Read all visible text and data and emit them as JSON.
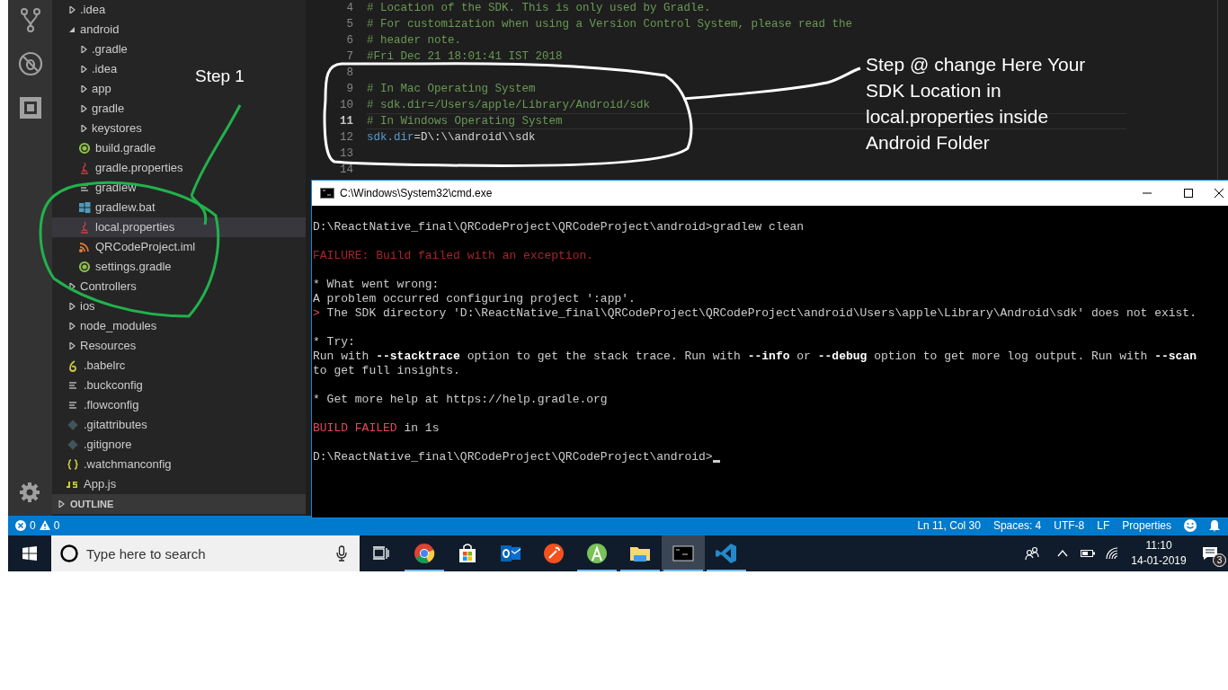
{
  "explorer": {
    "tree": [
      {
        "label": ".idea",
        "kind": "folder",
        "expanded": false,
        "selected": false
      },
      {
        "label": "android",
        "kind": "folder",
        "expanded": true,
        "selected": false,
        "children": [
          {
            "label": ".gradle",
            "kind": "folder",
            "expanded": false,
            "selected": false
          },
          {
            "label": ".idea",
            "kind": "folder",
            "expanded": false,
            "selected": false
          },
          {
            "label": "app",
            "kind": "folder",
            "expanded": false,
            "selected": false
          },
          {
            "label": "gradle",
            "kind": "folder",
            "expanded": false,
            "selected": false
          },
          {
            "label": "keystores",
            "kind": "folder",
            "expanded": false,
            "selected": false
          },
          {
            "label": "build.gradle",
            "kind": "gradle",
            "selected": false
          },
          {
            "label": "gradle.properties",
            "kind": "properties",
            "selected": false
          },
          {
            "label": "gradlew",
            "kind": "text",
            "selected": false
          },
          {
            "label": "gradlew.bat",
            "kind": "windows",
            "selected": false
          },
          {
            "label": "local.properties",
            "kind": "properties",
            "selected": true
          },
          {
            "label": "QRCodeProject.iml",
            "kind": "rss",
            "selected": false
          },
          {
            "label": "settings.gradle",
            "kind": "gradle",
            "selected": false
          }
        ]
      },
      {
        "label": "Controllers",
        "kind": "folder",
        "expanded": false,
        "selected": false
      },
      {
        "label": "ios",
        "kind": "folder",
        "expanded": false,
        "selected": false
      },
      {
        "label": "node_modules",
        "kind": "folder",
        "expanded": false,
        "selected": false
      },
      {
        "label": "Resources",
        "kind": "folder",
        "expanded": false,
        "selected": false
      },
      {
        "label": ".babelrc",
        "kind": "babel",
        "selected": false
      },
      {
        "label": ".buckconfig",
        "kind": "text",
        "selected": false
      },
      {
        "label": ".flowconfig",
        "kind": "text",
        "selected": false
      },
      {
        "label": ".gitattributes",
        "kind": "git",
        "selected": false
      },
      {
        "label": ".gitignore",
        "kind": "git",
        "selected": false
      },
      {
        "label": ".watchmanconfig",
        "kind": "json",
        "selected": false
      },
      {
        "label": "App.js",
        "kind": "js",
        "selected": false
      }
    ],
    "outline": {
      "label": "OUTLINE",
      "expanded": false
    }
  },
  "editor": {
    "lines": [
      {
        "number": "4",
        "kind": "comment",
        "text": "# Location of the SDK. This is only used by Gradle.",
        "current": false
      },
      {
        "number": "5",
        "kind": "comment",
        "text": "# For customization when using a Version Control System, please read the",
        "current": false
      },
      {
        "number": "6",
        "kind": "comment",
        "text": "# header note.",
        "current": false
      },
      {
        "number": "7",
        "kind": "comment",
        "text": "#Fri Dec 21 18:01:41 IST 2018",
        "current": false
      },
      {
        "number": "8",
        "kind": "blank",
        "current": false
      },
      {
        "number": "9",
        "kind": "comment",
        "text": "# In Mac Operating System",
        "current": false
      },
      {
        "number": "10",
        "kind": "comment",
        "text": "# sdk.dir=/Users/apple/Library/Android/sdk",
        "current": false
      },
      {
        "number": "11",
        "kind": "comment",
        "text": "# In Windows Operating System",
        "current": true
      },
      {
        "number": "12",
        "kind": "property",
        "key": "sdk.dir",
        "value": "=D\\:\\\\android\\\\sdk",
        "current": false
      },
      {
        "number": "13",
        "kind": "blank",
        "current": false
      },
      {
        "number": "14",
        "kind": "blank",
        "current": false
      }
    ]
  },
  "terminal": {
    "title": "C:\\Windows\\System32\\cmd.exe",
    "cursor": true,
    "paragraphs": [
      [
        [
          {
            "text": "D:\\ReactNative_final\\QRCodeProject\\QRCodeProject\\android>gradlew clean",
            "kind": "normal"
          }
        ]
      ],
      [
        [
          {
            "text": "FAILURE: Build failed with an exception.",
            "kind": "failure"
          }
        ]
      ],
      [
        [
          {
            "text": "* What went wrong:",
            "kind": "normal"
          }
        ],
        [
          {
            "text": "A problem occurred configuring project ':app'.",
            "kind": "normal"
          }
        ],
        [
          {
            "text": "> ",
            "kind": "error"
          },
          {
            "text": "The SDK directory 'D:\\ReactNative_final\\QRCodeProject\\QRCodeProject\\android\\Users\\apple\\Library\\Android\\sdk' does not exist.",
            "kind": "normal"
          }
        ]
      ],
      [
        [
          {
            "text": "* Try:",
            "kind": "normal"
          }
        ],
        [
          {
            "text": "Run with **--stacktrace** option to get the stack trace. Run with **--info** or **--debug** option to get more log output. Run with **--scan**",
            "kind": "normal"
          }
        ],
        [
          {
            "text": "to get full insights.",
            "kind": "normal"
          }
        ]
      ],
      [
        [
          {
            "text": "* Get more help at https://help.gradle.org",
            "kind": "normal"
          }
        ]
      ],
      [
        [
          {
            "text": "BUILD FAILED",
            "kind": "error"
          },
          {
            "text": " in 1s",
            "kind": "normal"
          }
        ]
      ],
      [
        [
          {
            "text": "D:\\ReactNative_final\\QRCodeProject\\QRCodeProject\\android>",
            "kind": "normal"
          }
        ]
      ]
    ]
  },
  "annotations": [
    {
      "kind": "step",
      "text": "Step 1"
    },
    {
      "kind": "note",
      "text": "Step @ change Here Your SDK Location in local.properties inside Android Folder"
    }
  ],
  "status_bar": {
    "errors": "0",
    "warnings": "0",
    "items": [
      "Ln 11, Col 30",
      "Spaces: 4",
      "UTF-8",
      "LF",
      "Properties"
    ]
  },
  "taskbar": {
    "search": {
      "placeholder": "Type here to search"
    },
    "apps": [
      {
        "kind": "chrome",
        "running": true,
        "active": false
      },
      {
        "kind": "store",
        "running": false,
        "active": false
      },
      {
        "kind": "outlook",
        "running": false,
        "active": false
      },
      {
        "kind": "tool",
        "running": false,
        "active": false
      },
      {
        "kind": "android-studio",
        "running": true,
        "active": false
      },
      {
        "kind": "explorer",
        "running": true,
        "active": false
      },
      {
        "kind": "cmd",
        "running": true,
        "active": true
      },
      {
        "kind": "vscode",
        "running": true,
        "active": false
      }
    ],
    "time": "11:10",
    "date": "14-01-2019",
    "notifications": "3"
  }
}
